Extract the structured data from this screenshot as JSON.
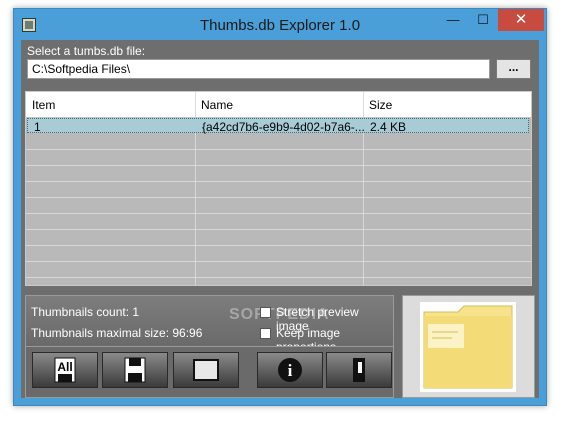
{
  "window": {
    "title": "Thumbs.db Explorer 1.0"
  },
  "controls": {
    "minimize": "—",
    "maximize": "☐",
    "close": "✕"
  },
  "file_select": {
    "label": "Select a tumbs.db file:",
    "path": "C:\\Softpedia Files\\",
    "browse_label": "..."
  },
  "list": {
    "columns": [
      "Item",
      "Name",
      "Size"
    ],
    "rows": [
      {
        "item": "1",
        "name": "{a42cd7b6-e9b9-4d02-b7a6-...",
        "size": "2.4 KB",
        "selected": true
      }
    ]
  },
  "info": {
    "count_label": "Thumbnails count: 1",
    "maxsize_label": "Thumbnails maximal size: 96:96",
    "stretch_label": "Stretch preview image",
    "keep_label": "Keep image proportions",
    "watermark": "SOFTPEDIA"
  },
  "toolbar": {
    "buttons": [
      {
        "name": "extract-all-button",
        "icon": "save-all-icon",
        "text": "All"
      },
      {
        "name": "save-button",
        "icon": "floppy-icon",
        "text": ""
      },
      {
        "name": "preview-button",
        "icon": "window-icon",
        "text": ""
      },
      {
        "name": "about-button",
        "icon": "info-icon",
        "text": "i"
      },
      {
        "name": "exit-button",
        "icon": "exit-door-icon",
        "text": ""
      }
    ]
  },
  "colors": {
    "titlebar": "#4a9fd8",
    "close": "#c74b3f",
    "panel": "#6e6e6e",
    "selection": "#a9cbd5",
    "folder": "#f6e38b"
  }
}
